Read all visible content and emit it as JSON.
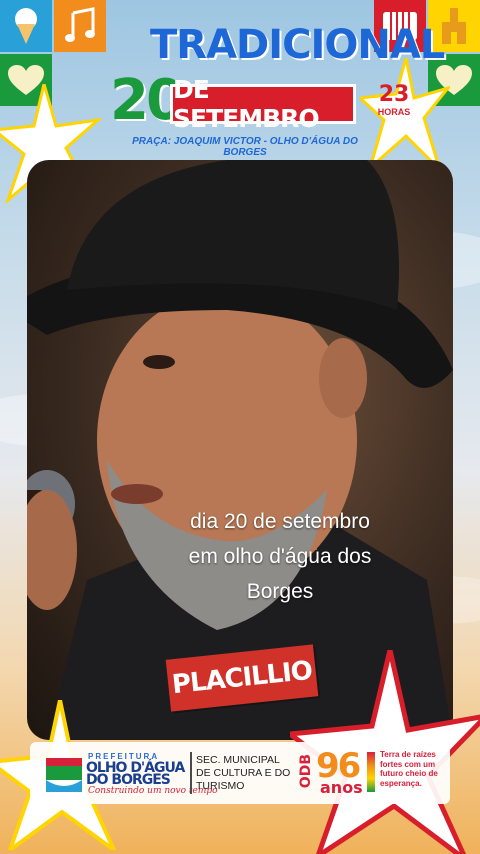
{
  "header": {
    "title": "TRADICIONAL",
    "date_number": "20",
    "date_month": "DE SETEMBRO",
    "hour_number": "23",
    "hour_label": "HORAS",
    "venue": "PRAÇA: JOAQUIM VICTOR - OLHO D'ÁGUA DO BORGES"
  },
  "icons": {
    "top_left_1": "ice-cream-icon",
    "top_left_2": "music-note-icon",
    "top_right_1": "accordion-icon",
    "top_right_2": "church-icon",
    "heart": "heart-icon"
  },
  "photo": {
    "caption_lines": [
      "dia 20 de setembro",
      "em olho d'água dos",
      "Borges"
    ],
    "artist_name": "PLACILLIO"
  },
  "footer": {
    "prefeitura": "PREFEITURA",
    "city_line_1": "OLHO D'ÁGUA",
    "city_line_2": "DO BORGES",
    "motto": "Construindo um novo tempo",
    "secretariat_lines": [
      "SEC. MUNICIPAL",
      "DE CULTURA E DO",
      "TURISMO"
    ],
    "anniversary_prefix": "ODB",
    "anniversary_number": "96",
    "anniversary_label": "anos",
    "tagline_lines": [
      "Terra de raízes",
      "fortes com um",
      "futuro cheio de",
      "esperança."
    ]
  },
  "colors": {
    "blue": "#1e67d6",
    "green": "#1a9a3c",
    "red": "#d81e2a",
    "orange": "#f28c1d",
    "yellow": "#ffd400"
  }
}
